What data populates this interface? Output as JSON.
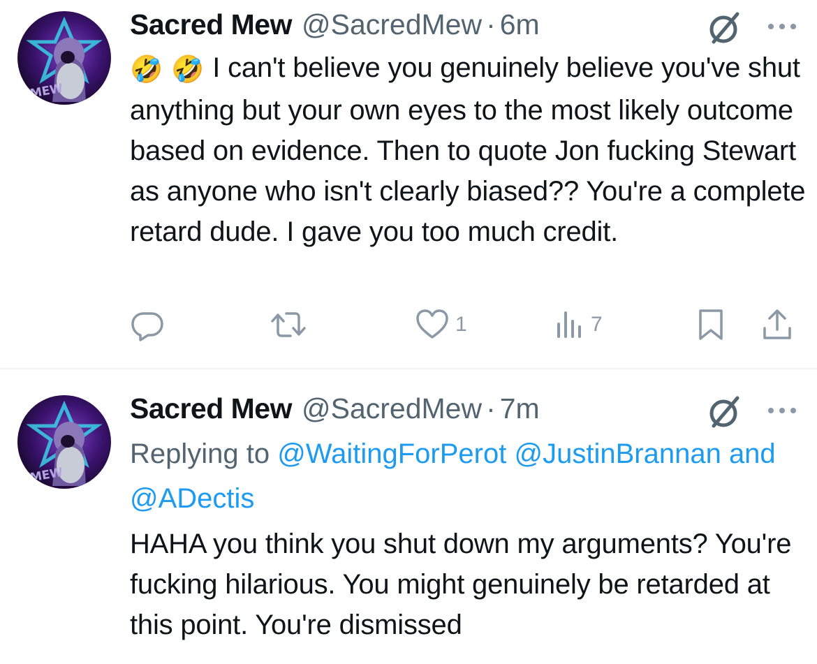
{
  "tweets": [
    {
      "display_name": "Sacred Mew",
      "handle": "@SacredMew",
      "separator": "·",
      "time": "6m",
      "emojis": [
        "🤣",
        "🤣"
      ],
      "text": "I can't believe you genuinely believe you've shut anything but your own eyes to the most likely outcome based on evidence. Then to quote Jon fucking Stewart as anyone who isn't clearly biased?? You're a complete retard dude. I gave you too much credit.",
      "actions": {
        "reply_icon": "reply-icon",
        "retweet_icon": "retweet-icon",
        "like_icon": "heart-icon",
        "like_count": "1",
        "views_icon": "views-icon",
        "views_count": "7",
        "bookmark_icon": "bookmark-icon",
        "share_icon": "share-icon"
      }
    },
    {
      "display_name": "Sacred Mew",
      "handle": "@SacredMew",
      "separator": "·",
      "time": "7m",
      "replying_prefix": "Replying to",
      "replying_mentions": [
        "@WaitingForPerot",
        "@JustinBrannan"
      ],
      "replying_and": "and",
      "replying_last": "@ADectis",
      "text": "HAHA you think you shut down my arguments? You're fucking hilarious. You might genuinely be retarded at this point. You're dismissed"
    }
  ],
  "colors": {
    "text": "#0f1419",
    "secondary": "#536471",
    "link": "#1d9bf0",
    "icon": "#8b98a5",
    "divider": "#eff3f4"
  },
  "avatar_text": "MEW"
}
